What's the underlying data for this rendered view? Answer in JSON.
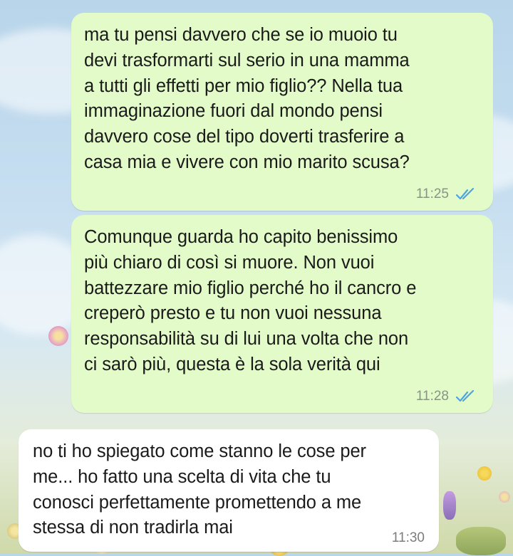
{
  "conversation": {
    "messages": [
      {
        "direction": "outgoing",
        "text": "ma tu pensi davvero che se io muoio tu\ndevi trasformarti sul serio in una mamma\na tutti gli effetti per mio figlio?? Nella tua\nimmaginazione fuori dal mondo pensi\ndavvero cose del tipo doverti trasferire a\ncasa mia e vivere con mio marito scusa?",
        "time": "11:25",
        "status_icon": "double-check-read-icon"
      },
      {
        "direction": "outgoing",
        "text": "Comunque guarda ho capito benissimo\npiù chiaro di così si muore. Non vuoi\nbattezzare mio figlio perché ho il cancro e\ncreperò presto e tu non vuoi nessuna\nresponsabilità su di lui una volta che non\nci sarò più, questa è la sola verità qui",
        "time": "11:28",
        "status_icon": "double-check-read-icon"
      },
      {
        "direction": "incoming",
        "text": "no ti ho spiegato come stanno le cose per\nme... ho fatto una scelta di vita che tu\nconosci perfettamente promettendo a me\nstessa di non tradirla mai",
        "time": "11:30"
      }
    ]
  },
  "colors": {
    "outgoing_bubble": "#e2fbc9",
    "incoming_bubble": "#ffffff",
    "read_ticks": "#4fa3e0"
  }
}
